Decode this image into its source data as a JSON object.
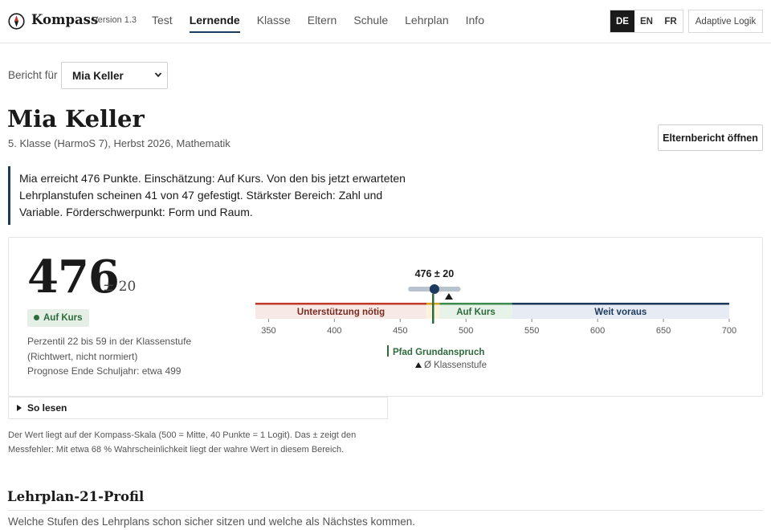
{
  "header": {
    "brand": "Kompass",
    "version": "Version 1.3",
    "tabs": [
      {
        "label": "Test",
        "active": false
      },
      {
        "label": "Lernende",
        "active": true
      },
      {
        "label": "Klasse",
        "active": false
      },
      {
        "label": "Eltern",
        "active": false
      },
      {
        "label": "Schule",
        "active": false
      },
      {
        "label": "Lehrplan",
        "active": false
      },
      {
        "label": "Info",
        "active": false
      }
    ],
    "languages": [
      {
        "label": "DE",
        "active": true
      },
      {
        "label": "EN",
        "active": false
      },
      {
        "label": "FR",
        "active": false
      }
    ],
    "adaptive_label": "Adaptive Logik"
  },
  "report": {
    "label": "Bericht für",
    "selected_student": "Mia Keller"
  },
  "student": {
    "name": "Mia Keller",
    "meta": "5. Klasse (HarmoS 7), Herbst 2026, Mathematik",
    "parent_report_button": "Elternbericht öffnen"
  },
  "summary": "Mia erreicht 476 Punkte. Einschätzung: Auf Kurs. Von den bis jetzt erwarteten Lehrplanstufen scheinen 41 von 47 gefestigt. Stärkster Bereich: Zahl und Variable. Förderschwerpunkt: Form und Raum.",
  "score_card": {
    "score": "476",
    "error": "± 20",
    "status": "Auf Kurs",
    "percentile": "Perzentil 22 bis 59 in der Klassenstufe",
    "percentile_note": "(Richtwert, nicht normiert)",
    "forecast": "Prognose Ende Schuljahr: etwa 499"
  },
  "scale": {
    "min": 340,
    "max": 700,
    "score": 476,
    "error": 20,
    "score_label": "476 ± 20",
    "ticks": [
      350,
      400,
      450,
      500,
      550,
      600,
      650,
      700
    ],
    "bands": [
      {
        "label": "Unterstützung nötig",
        "from": 340,
        "to": 470,
        "fill": "#f7e9e5",
        "line": "#c0392b",
        "text": "#7a2a20"
      },
      {
        "label": "",
        "from": 470,
        "to": 480,
        "fill": "#faf3dc",
        "line": "#d4a21c",
        "text": "#6b5a1a"
      },
      {
        "label": "Auf Kurs",
        "from": 480,
        "to": 535,
        "fill": "#e7f2e8",
        "line": "#3c8a4c",
        "text": "#2d6a3c"
      },
      {
        "label": "Weit voraus",
        "from": 535,
        "to": 700,
        "fill": "#e7ecf4",
        "line": "#1c3a5e",
        "text": "#1c3a5e"
      }
    ],
    "pathway": {
      "value": 475,
      "label": "Pfad Grundanspruch"
    },
    "grade_average": {
      "value": 487,
      "label": "Ø Klassenstufe"
    },
    "colors": {
      "marker": "#1c3a5e",
      "pathway": "#2d6a3c",
      "interval": "#b9c3ce"
    }
  },
  "explanation": {
    "toggle": "So lesen",
    "note": "Der Wert liegt auf der Kompass-Skala (500 = Mitte, 40 Punkte = 1 Logit). Das ± zeigt den Messfehler: Mit etwa 68 % Wahrscheinlichkeit liegt der wahre Wert in diesem Bereich."
  },
  "profile": {
    "title": "Lehrplan-21-Profil",
    "subtitle": "Welche Stufen des Lehrplans schon sicher sitzen und welche als Nächstes kommen."
  }
}
